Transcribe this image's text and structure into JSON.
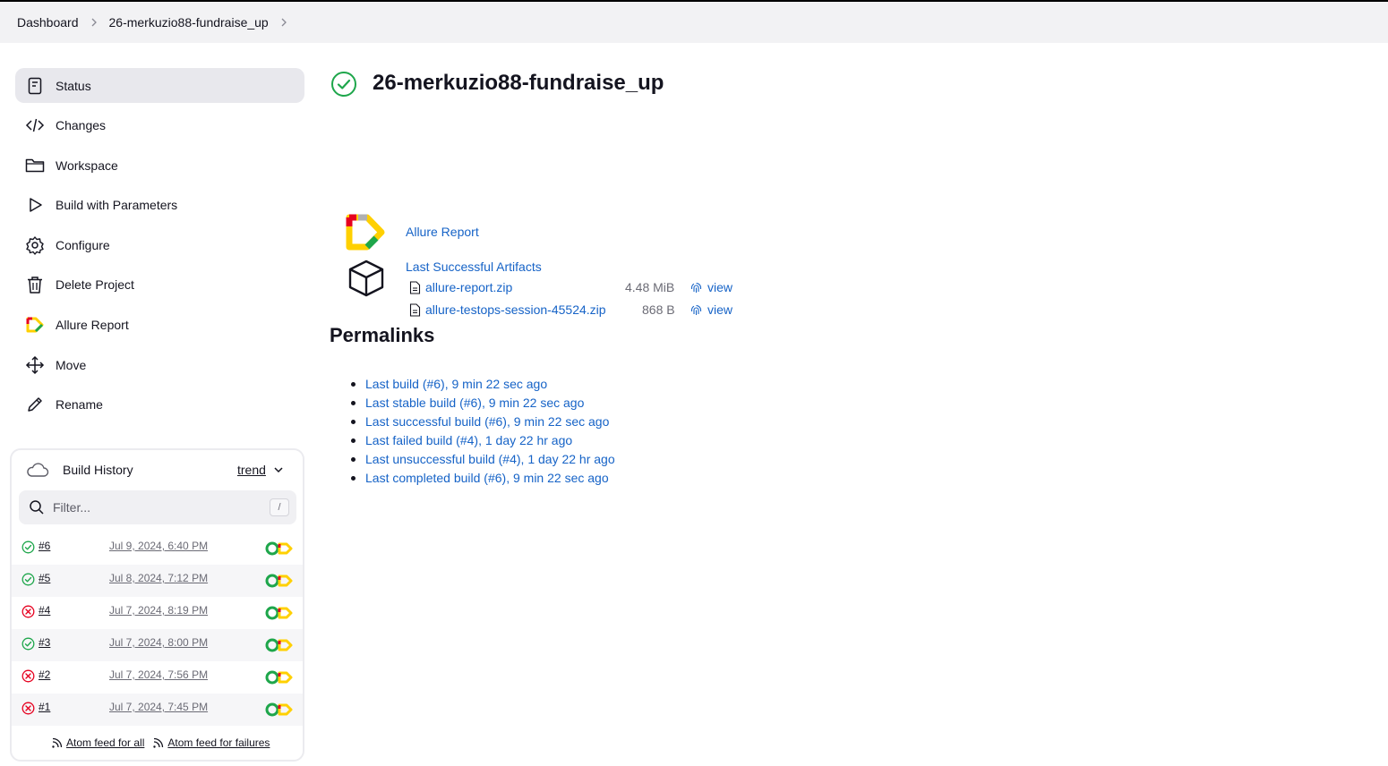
{
  "breadcrumb": {
    "items": [
      "Dashboard",
      "26-merkuzio88-fundraise_up"
    ]
  },
  "sidebar": {
    "tasks": [
      {
        "label": "Status",
        "icon": "status-icon"
      },
      {
        "label": "Changes",
        "icon": "code-icon"
      },
      {
        "label": "Workspace",
        "icon": "folder-icon"
      },
      {
        "label": "Build with Parameters",
        "icon": "play-icon"
      },
      {
        "label": "Configure",
        "icon": "gear-icon"
      },
      {
        "label": "Delete Project",
        "icon": "trash-icon"
      },
      {
        "label": "Allure Report",
        "icon": "allure-icon"
      },
      {
        "label": "Move",
        "icon": "move-icon"
      },
      {
        "label": "Rename",
        "icon": "pencil-icon"
      }
    ]
  },
  "build_history": {
    "title": "Build History",
    "trend_label": "trend",
    "filter_placeholder": "Filter...",
    "filter_shortcut": "/",
    "builds": [
      {
        "number": "#6",
        "date": "Jul 9, 2024, 6:40 PM",
        "status": "success"
      },
      {
        "number": "#5",
        "date": "Jul 8, 2024, 7:12 PM",
        "status": "success"
      },
      {
        "number": "#4",
        "date": "Jul 7, 2024, 8:19 PM",
        "status": "failed"
      },
      {
        "number": "#3",
        "date": "Jul 7, 2024, 8:00 PM",
        "status": "success"
      },
      {
        "number": "#2",
        "date": "Jul 7, 2024, 7:56 PM",
        "status": "failed"
      },
      {
        "number": "#1",
        "date": "Jul 7, 2024, 7:45 PM",
        "status": "failed"
      }
    ],
    "feed_all": "Atom feed for all",
    "feed_failures": "Atom feed for failures"
  },
  "main": {
    "title": "26-merkuzio88-fundraise_up",
    "allure_link": "Allure Report",
    "artifacts_link": "Last Successful Artifacts",
    "files": [
      {
        "name": "allure-report.zip",
        "size": "4.48 MiB",
        "view": "view"
      },
      {
        "name": "allure-testops-session-45524.zip",
        "size": "868 B",
        "view": "view"
      }
    ],
    "permalinks_title": "Permalinks",
    "permalinks": [
      "Last build (#6), 9 min 22 sec ago",
      "Last stable build (#6), 9 min 22 sec ago",
      "Last successful build (#6), 9 min 22 sec ago",
      "Last failed build (#4), 1 day 22 hr ago",
      "Last unsuccessful build (#4), 1 day 22 hr ago",
      "Last completed build (#6), 9 min 22 sec ago"
    ]
  },
  "colors": {
    "success": "#1ea64b",
    "failed": "#e6001f",
    "link": "#1663c7"
  }
}
